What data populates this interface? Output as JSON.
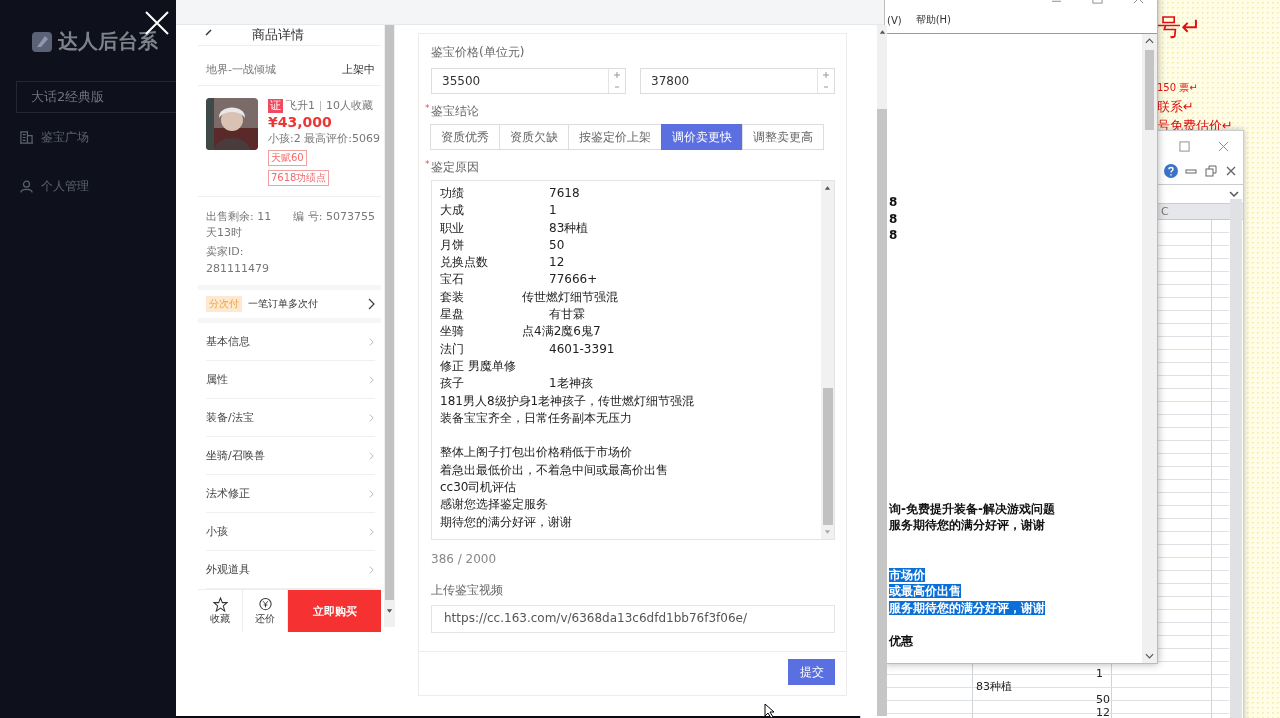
{
  "admin": {
    "logo": "达人后台系",
    "game_select": "大话2经典版",
    "menu": [
      {
        "label": "鉴宝广场"
      },
      {
        "label": "个人管理"
      }
    ]
  },
  "product": {
    "header_title": "商品详情",
    "server": "地界-一战倾城",
    "status": "上架中",
    "badge": "证",
    "meta_1": "飞升1",
    "meta_2": "10人收藏",
    "price": "¥43,000",
    "stats": "小孩:2 最高评价:5069",
    "tags": [
      "天赋60",
      "7618功绩点"
    ],
    "sale_remaining": "出售剩余: 11天13时",
    "serial": "编 号: 5073755",
    "seller": "卖家ID: 281111479",
    "installment_badge": "分次付",
    "installment_text": "一笔订单多次付",
    "sections": [
      "基本信息",
      "属性",
      "装备/法宝",
      "坐骑/召唤兽",
      "法术修正",
      "小孩",
      "外观道具"
    ],
    "actions": [
      {
        "label": "收藏"
      },
      {
        "label": "还价"
      }
    ],
    "buy_button": "立即购买"
  },
  "form": {
    "price_label": "鉴宝价格(单位元)",
    "price_min": "35500",
    "price_max": "37800",
    "conclusion": {
      "label": "鉴宝结论",
      "required_mark": "*",
      "options": [
        {
          "label": "资质优秀",
          "selected": false
        },
        {
          "label": "资质欠缺",
          "selected": false
        },
        {
          "label": "按鉴定价上架",
          "selected": false
        },
        {
          "label": "调价卖更快",
          "selected": true
        },
        {
          "label": "调整卖更高",
          "selected": false
        }
      ]
    },
    "reason": {
      "label": "鉴定原因",
      "required_mark": "*",
      "lines": [
        {
          "kind": "pair",
          "key": "功绩",
          "value": "7618"
        },
        {
          "kind": "pair",
          "key": "大成",
          "value": "1"
        },
        {
          "kind": "pair",
          "key": "职业",
          "value": "83种植"
        },
        {
          "kind": "pair",
          "key": "月饼",
          "value": "50"
        },
        {
          "kind": "pair",
          "key": "兑换点数",
          "value": "12"
        },
        {
          "kind": "pair",
          "key": "宝石",
          "value": "77666+"
        },
        {
          "kind": "pair_short",
          "key": "套装",
          "value": "传世燃灯细节强混"
        },
        {
          "kind": "pair",
          "key": "星盘",
          "value": "有甘霖"
        },
        {
          "kind": "pair_short",
          "key": "坐骑",
          "value": "点4满2魔6鬼7"
        },
        {
          "kind": "pair",
          "key": "法门",
          "value": "4601-3391"
        },
        {
          "kind": "text",
          "text": "修正 男魔单修"
        },
        {
          "kind": "pair",
          "key": "孩子",
          "value": "1老神孩"
        },
        {
          "kind": "text",
          "text": "181男人8级护身1老神孩子，传世燃灯细节强混"
        },
        {
          "kind": "text",
          "text": "装备宝宝齐全，日常任务副本无压力"
        },
        {
          "kind": "blank"
        },
        {
          "kind": "text",
          "text": "整体上阁子打包出价格稍低于市场价"
        },
        {
          "kind": "text",
          "text": "着急出最低价出，不着急中间或最高价出售"
        },
        {
          "kind": "text",
          "text": "cc30司机评估"
        },
        {
          "kind": "text",
          "text": "感谢您选择鉴定服务"
        },
        {
          "kind": "text",
          "text": "期待您的满分好评，谢谢"
        }
      ]
    },
    "count": "386 / 2000",
    "video_label": "上传鉴宝视频",
    "video_url": "https://cc.163.com/v/6368da13c6dfd1bb76f3f06e/",
    "submit": "提交"
  },
  "notepad": {
    "menu": [
      "(V)",
      "帮助(H)"
    ],
    "top_lines": [
      {
        "text": "8",
        "selected": false
      },
      {
        "text": "8",
        "selected": false
      },
      {
        "text": "8",
        "selected": false
      }
    ],
    "bottom_paragraphs": [
      {
        "lines": [
          {
            "text": "询-免费提升装备-解决游戏问题",
            "selected": false
          },
          {
            "text": "服务期待您的满分好评，谢谢",
            "selected": false
          }
        ]
      },
      {
        "lines": [
          {
            "text": "市场价",
            "selected": true
          },
          {
            "text": "或最高价出售",
            "selected": true
          },
          {
            "text": "服务期待您的满分好评，谢谢",
            "selected": true
          }
        ]
      },
      {
        "lines": [
          {
            "text": "优惠",
            "selected": false
          }
        ]
      }
    ]
  },
  "spreadsheet": {
    "column_header": "C",
    "rows": [
      {
        "kind": "number",
        "text": "1"
      },
      {
        "kind": "text",
        "text": "83种植"
      },
      {
        "kind": "number",
        "text": "50"
      },
      {
        "kind": "number",
        "text": "12"
      }
    ]
  },
  "document": {
    "heading": "号↵",
    "lines": [
      "150 票↵",
      "联系↵",
      "号免费估价↵"
    ]
  }
}
